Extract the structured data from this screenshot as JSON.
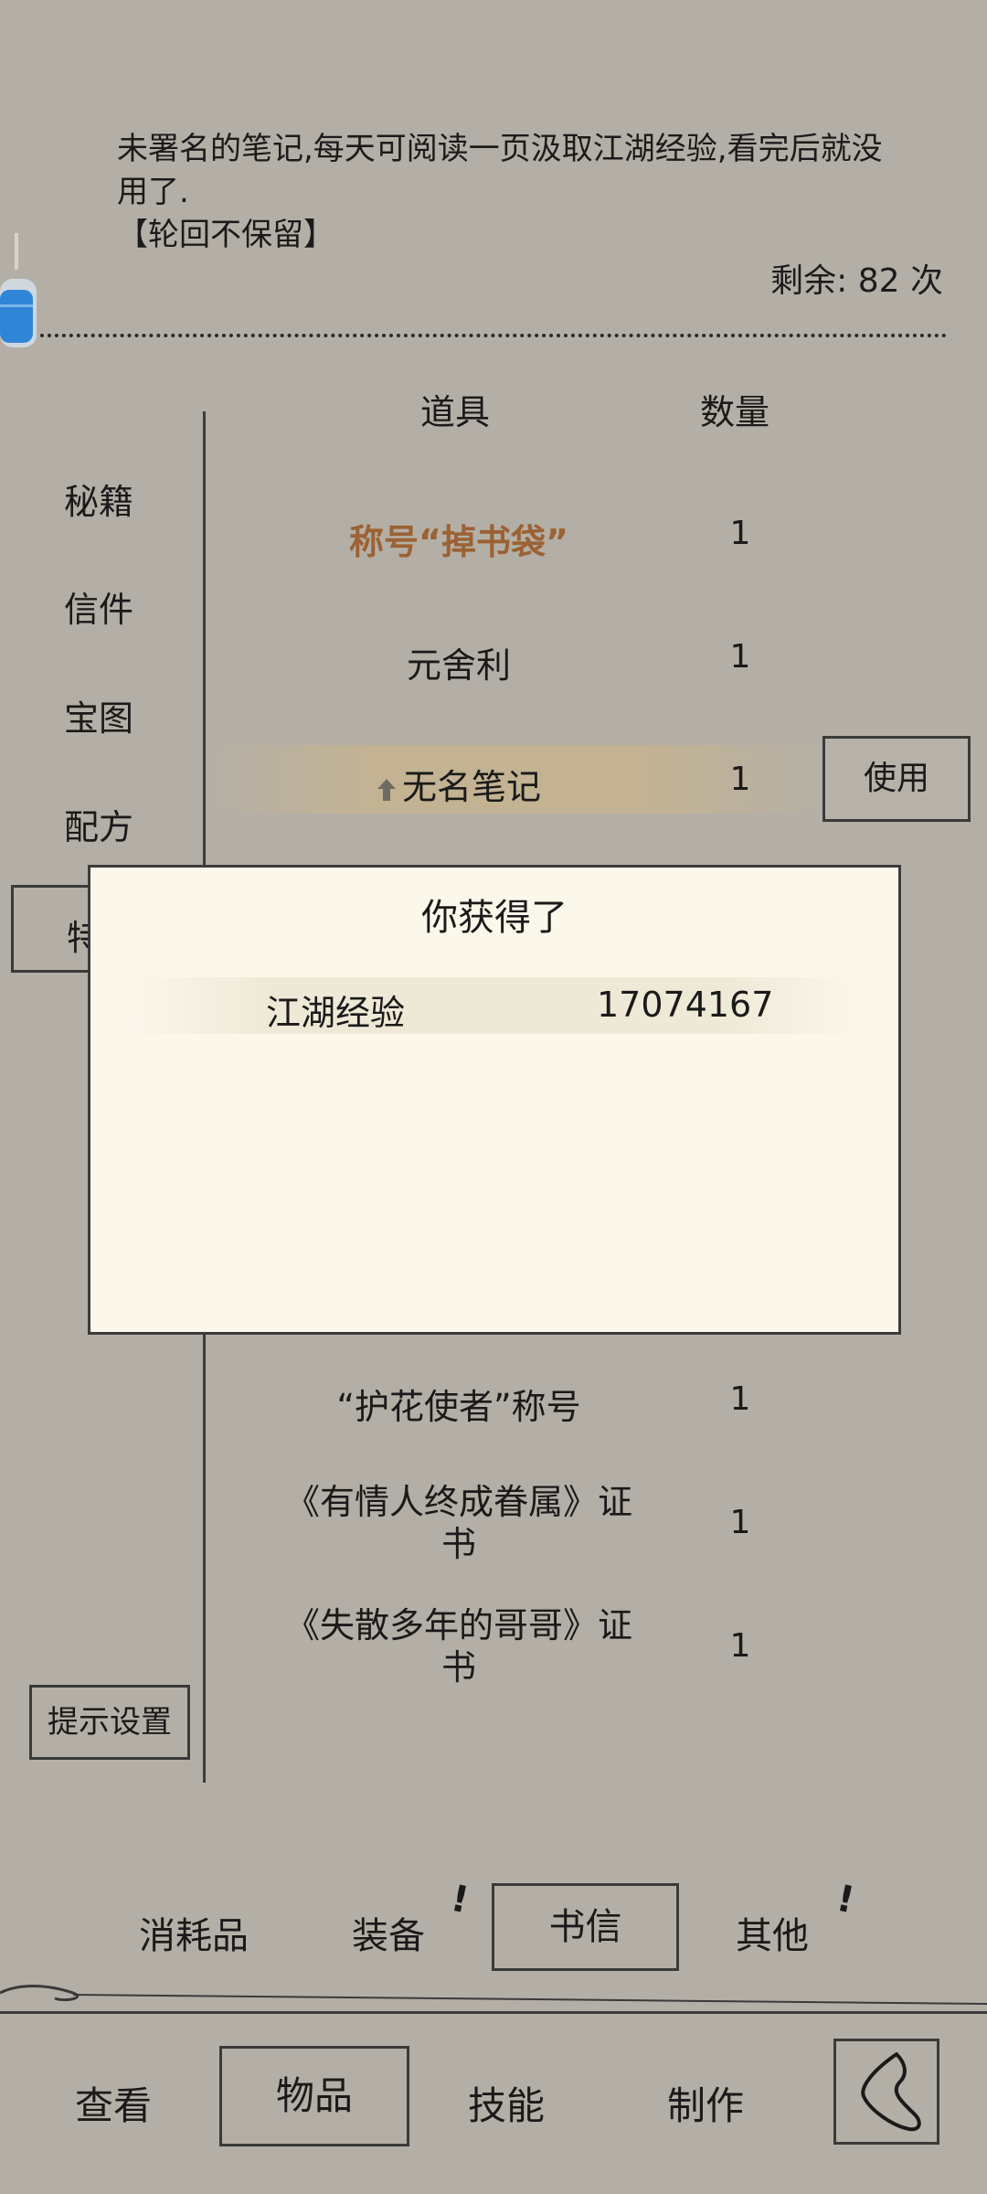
{
  "item_detail": {
    "description": "未署名的笔记,每天可阅读一页汲取江湖经验,看完后就没用了.",
    "tag": "【轮回不保留】",
    "remaining": "剩余: 82 次"
  },
  "columns": {
    "item": "道具",
    "qty": "数量"
  },
  "categories": [
    "秘籍",
    "信件",
    "宝图",
    "配方",
    "特"
  ],
  "items_top": [
    {
      "name": "称号“掉书袋”",
      "qty": "1"
    },
    {
      "name": "元舍利",
      "qty": "1"
    },
    {
      "name": "无名笔记",
      "qty": "1"
    }
  ],
  "use_button": "使用",
  "items_bottom": [
    {
      "name": "“护花使者”称号",
      "qty": "1"
    },
    {
      "name_line1": "《有情人终成眷属》证",
      "name_line2": "书",
      "qty": "1"
    },
    {
      "name_line1": "《失散多年的哥哥》证",
      "name_line2": "书",
      "qty": "1"
    }
  ],
  "popup": {
    "title": "你获得了",
    "label": "江湖经验",
    "value": "17074167"
  },
  "hint_settings": "提示设置",
  "subtabs": [
    "消耗品",
    "装备",
    "书信",
    "其他"
  ],
  "bottom_nav": [
    "查看",
    "物品",
    "技能",
    "制作"
  ],
  "colors": {
    "background": "#b4afa6",
    "popup": "#fbf7eb",
    "title_item": "#9c6134"
  }
}
